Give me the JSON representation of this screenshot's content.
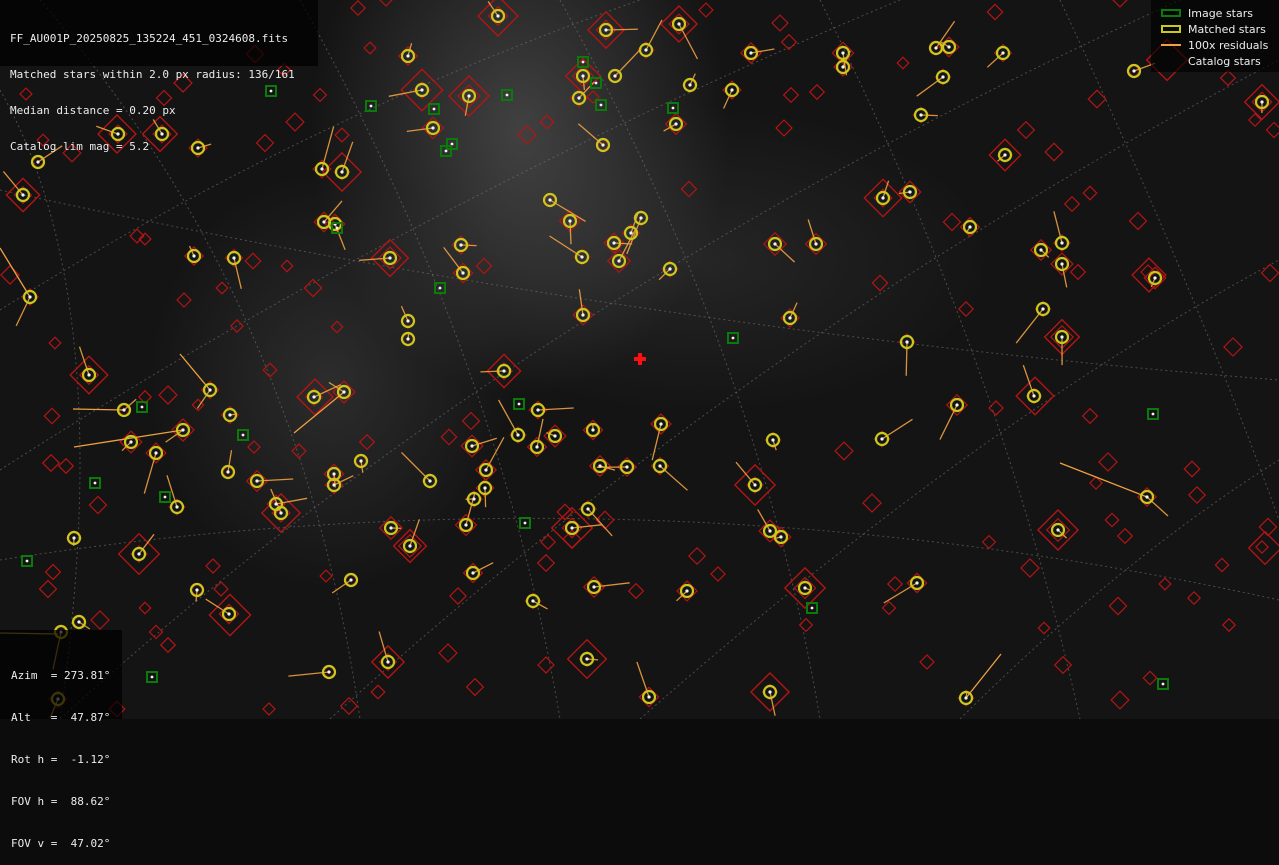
{
  "file": {
    "name": "FF_AU001P_20250825_135224_451_0324608.fits",
    "matched_line": "Matched stars within 2.0 px radius: 136/161",
    "median_line": "Median distance = 0.20 px",
    "catalog_line": "Catalog lim mag = 5.2"
  },
  "legend": {
    "image_stars": "Image stars",
    "matched_stars": "Matched stars",
    "residuals": "100x residuals",
    "catalog_stars": "Catalog stars"
  },
  "pointing": {
    "azim": "Azim  = 273.81°",
    "alt": "Alt   =  47.87°",
    "rot": "Rot h =  -1.12°",
    "fov_h": "FOV h =  88.62°",
    "fov_v": "FOV v =  47.02°"
  },
  "colors": {
    "image_star": "#0a7a0a",
    "matched_star": "#c8c81e",
    "residual": "#f0a040",
    "catalog_star": "#b41414",
    "center": "#ff1010"
  }
}
